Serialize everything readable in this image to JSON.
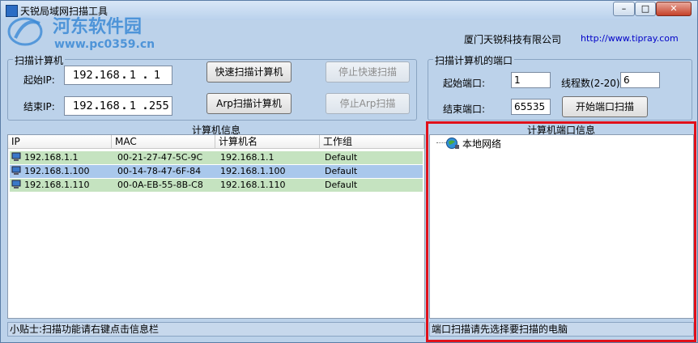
{
  "window": {
    "title": "天锐局域网扫描工具",
    "controls": {
      "minimize": "–",
      "maximize": "□",
      "close": "✕"
    }
  },
  "watermark": {
    "name": "河东软件园",
    "url": "www.pc0359.cn"
  },
  "header": {
    "company": "厦门天锐科技有限公司",
    "url": "http://www.tipray.com"
  },
  "scan_computers": {
    "title": "扫描计算机",
    "start_label": "起始IP:",
    "end_label": "结束IP:",
    "start_ip": [
      "192",
      "168",
      "1",
      "1"
    ],
    "end_ip": [
      "192",
      "168",
      "1",
      "255"
    ],
    "quick_scan": "快速扫描计算机",
    "stop_quick_scan": "停止快速扫描",
    "arp_scan": "Arp扫描计算机",
    "stop_arp_scan": "停止Arp扫描"
  },
  "scan_ports": {
    "title": "扫描计算机的端口",
    "start_port_label": "起始端口:",
    "start_port": "1",
    "threads_label": "线程数(2-20):",
    "threads": "6",
    "end_port_label": "结束端口:",
    "end_port": "65535",
    "start_button": "开始端口扫描"
  },
  "computer_info": {
    "title": "计算机信息",
    "columns": [
      "IP",
      "MAC",
      "计算机名",
      "工作组"
    ],
    "rows": [
      {
        "ip": "192.168.1.1",
        "mac": "00-21-27-47-5C-9C",
        "name": "192.168.1.1",
        "group": "Default",
        "color": "#c5e3c0"
      },
      {
        "ip": "192.168.1.100",
        "mac": "00-14-78-47-6F-84",
        "name": "192.168.1.100",
        "group": "Default",
        "color": "#a9c8ec"
      },
      {
        "ip": "192.168.1.110",
        "mac": "00-0A-EB-55-8B-C8",
        "name": "192.168.1.110",
        "group": "Default",
        "color": "#c5e3c0"
      }
    ]
  },
  "port_info": {
    "title": "计算机端口信息",
    "tree_root": "本地网络"
  },
  "status": {
    "left": "小贴士:扫描功能请右键点击信息栏",
    "right": "端口扫描请先选择要扫描的电脑"
  },
  "colors": {
    "highlight": "#e0101a",
    "window_bg": "#bcd2ea",
    "url": "#0000c8"
  }
}
